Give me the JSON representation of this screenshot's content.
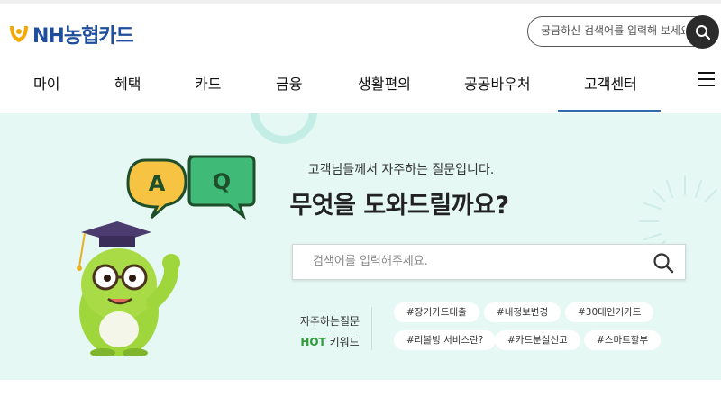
{
  "brand": {
    "name": "NH농협카드"
  },
  "top_search": {
    "placeholder": "궁금하신 검색어를 입력해 보세요."
  },
  "nav": {
    "items": [
      {
        "label": "마이"
      },
      {
        "label": "혜택"
      },
      {
        "label": "카드"
      },
      {
        "label": "금융"
      },
      {
        "label": "생활편의"
      },
      {
        "label": "공공바우처"
      },
      {
        "label": "고객센터",
        "active": true
      }
    ]
  },
  "hero": {
    "subtitle": "고객님들께서 자주하는 질문입니다.",
    "title": "무엇을 도와드릴까요?",
    "bubbles": {
      "a": "A",
      "q": "Q"
    },
    "search_placeholder": "검색어를 입력해주세요.",
    "keywords_label_line1": "자주하는질문",
    "keywords_label_hot": "HOT",
    "keywords_label_rest": " 키워드",
    "tags": [
      "#장기카드대출",
      "#내정보변경",
      "#30대인기카드",
      "#리볼빙 서비스란?",
      "#카드분실신고",
      "#스마트할부"
    ]
  },
  "colors": {
    "brand_blue": "#1f4e9c",
    "accent_underline": "#2d6bb3",
    "hero_bg": "#e5f8f4",
    "hot_green": "#2f9b3a",
    "character_green": "#9fd63b"
  }
}
